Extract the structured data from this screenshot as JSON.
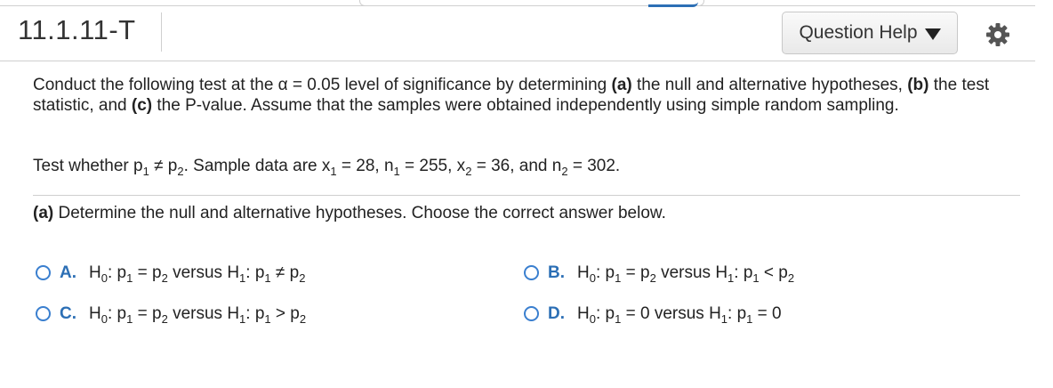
{
  "header": {
    "question_id": "11.1.11-T",
    "help_label": "Question Help"
  },
  "problem": {
    "p_start": "Conduct the following test at the ",
    "alpha_sym": "α",
    "p_alpha": " = 0.05 level of significance by determining ",
    "a_tag": "(a)",
    "p_a": " the null and alternative hypotheses, ",
    "b_tag": "(b)",
    "p_b": " the test statistic, and ",
    "c_tag": "(c)",
    "p_c": " the P-value. Assume that the samples were obtained independently using simple random sampling."
  },
  "test": {
    "t1": "Test whether p",
    "s1": "1",
    "t2": " ≠ p",
    "s2": "2",
    "t3": ". Sample data are x",
    "s3": "1",
    "t4": " = 28, n",
    "s4": "1",
    "t5": " = 255, x",
    "s5": "2",
    "t6": " = 36, and n",
    "s6": "2",
    "t7": " = 302."
  },
  "part_a": {
    "tag": "(a)",
    "text": " Determine the null and alternative hypotheses. Choose the correct answer below."
  },
  "options": [
    {
      "letter": "A.",
      "parts": [
        "H",
        "0",
        ": p",
        "1",
        " = p",
        "2",
        " versus H",
        "1",
        ": p",
        "1",
        " ≠ p",
        "2"
      ]
    },
    {
      "letter": "B.",
      "parts": [
        "H",
        "0",
        ": p",
        "1",
        " = p",
        "2",
        " versus H",
        "1",
        ": p",
        "1",
        " < p",
        "2"
      ]
    },
    {
      "letter": "C.",
      "parts": [
        "H",
        "0",
        ": p",
        "1",
        " = p",
        "2",
        " versus H",
        "1",
        ": p",
        "1",
        " > p",
        "2"
      ]
    },
    {
      "letter": "D.",
      "parts": [
        "H",
        "0",
        ": p",
        "1",
        " = 0 versus H",
        "1",
        ": p",
        "1",
        " = 0",
        ""
      ]
    }
  ]
}
